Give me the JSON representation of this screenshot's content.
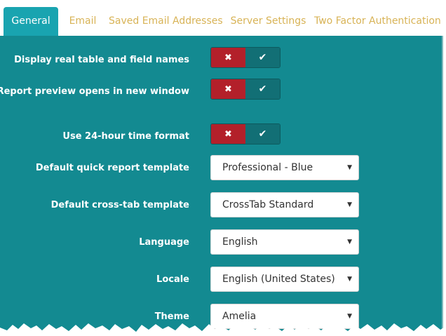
{
  "tabs": [
    {
      "label": "General",
      "active": true
    },
    {
      "label": "Email",
      "active": false
    },
    {
      "label": "Saved Email Addresses",
      "active": false
    },
    {
      "label": "Server Settings",
      "active": false
    },
    {
      "label": "Two Factor Authentication",
      "active": false
    }
  ],
  "toggles": [
    {
      "label": "Display real table and field names",
      "off_icon": "times-icon",
      "on_icon": "check-icon"
    },
    {
      "label": "Report preview opens in new window",
      "off_icon": "times-icon",
      "on_icon": "check-icon"
    },
    {
      "label": "Use 24-hour time format",
      "off_icon": "times-icon",
      "on_icon": "check-icon"
    }
  ],
  "selects": [
    {
      "label": "Default quick report template",
      "value": "Professional - Blue"
    },
    {
      "label": "Default cross-tab template",
      "value": "CrossTab Standard"
    },
    {
      "label": "Language",
      "value": "English"
    },
    {
      "label": "Locale",
      "value": "English (United States)"
    },
    {
      "label": "Theme",
      "value": "Amelia"
    }
  ],
  "glyphs": {
    "off": "✖",
    "on": "✔",
    "caret": "▼"
  },
  "colors": {
    "panel": "#138a91",
    "active_tab": "#19a4b0",
    "inactive_tab_text": "#d8b356",
    "toggle_off": "#b3202a",
    "toggle_on": "#126f75"
  }
}
